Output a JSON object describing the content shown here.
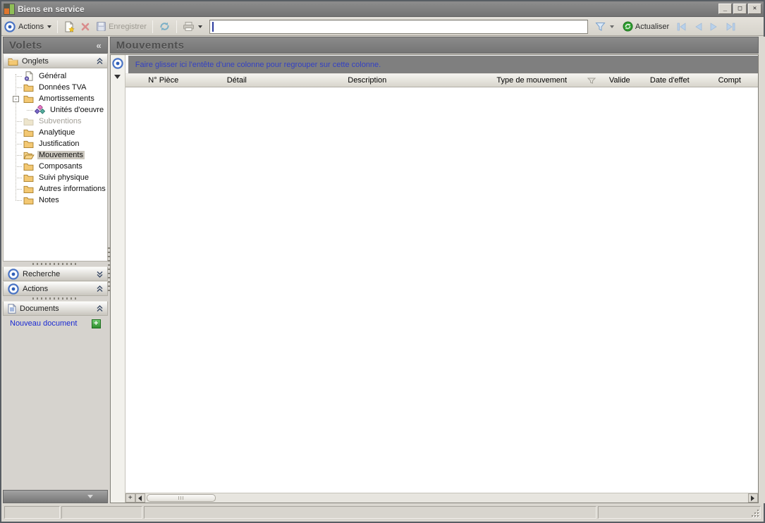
{
  "window": {
    "title": "Biens en service",
    "controls": {
      "minimize": "_",
      "maximize": "□",
      "close": "✕"
    }
  },
  "toolbar": {
    "actions_label": "Actions",
    "save_label": "Enregistrer",
    "refresh_label": "Actualiser",
    "filter_value": ""
  },
  "sidebar": {
    "title": "Volets",
    "collapse_glyph": "«",
    "sections": {
      "onglets": {
        "label": "Onglets"
      },
      "recherche": {
        "label": "Recherche"
      },
      "actions": {
        "label": "Actions"
      },
      "documents": {
        "label": "Documents"
      }
    },
    "tree": {
      "items": [
        {
          "label": "Général",
          "icon": "page-gear-icon"
        },
        {
          "label": "Données TVA",
          "icon": "folder-icon"
        },
        {
          "label": "Amortissements",
          "icon": "folder-icon",
          "expander": "-"
        },
        {
          "label": "Unités d'oeuvre",
          "icon": "modules-icon",
          "level": 2
        },
        {
          "label": "Subventions",
          "icon": "folder-disabled-icon",
          "disabled": true
        },
        {
          "label": "Analytique",
          "icon": "folder-icon"
        },
        {
          "label": "Justification",
          "icon": "folder-icon"
        },
        {
          "label": "Mouvements",
          "icon": "folder-open-icon",
          "selected": true
        },
        {
          "label": "Composants",
          "icon": "folder-icon"
        },
        {
          "label": "Suivi physique",
          "icon": "folder-icon"
        },
        {
          "label": "Autres informations",
          "icon": "folder-icon"
        },
        {
          "label": "Notes",
          "icon": "folder-icon"
        }
      ]
    },
    "documents_panel": {
      "new_document_label": "Nouveau document"
    }
  },
  "main": {
    "title": "Mouvements",
    "group_hint": "Faire glisser ici l'entête d'une colonne pour regrouper sur cette colonne.",
    "columns": [
      {
        "label": "N° Pièce"
      },
      {
        "label": "Détail"
      },
      {
        "label": "Description"
      },
      {
        "label": "Type de mouvement",
        "filter": true
      },
      {
        "label": "Valide"
      },
      {
        "label": "Date d'effet"
      },
      {
        "label": "Compt"
      }
    ]
  },
  "icons": {
    "app_logo": "orange-green-bar-chart",
    "target": "blue-bullseye",
    "new_item": "page-with-star",
    "delete_item": "red-x",
    "save": "floppy-disk",
    "refresh": "blue-double-arrows",
    "print": "printer",
    "filter": "funnel",
    "actualiser": "green-refresh-circle",
    "nav": "first-prev-next-last-arrows"
  },
  "colors": {
    "caption_gray": "#7f7f7f",
    "hint_blue": "#3340c4",
    "link_blue": "#1a2ad2",
    "folder_yellow": "#f3c873",
    "toolbar_bg": "#dcd9d2"
  }
}
